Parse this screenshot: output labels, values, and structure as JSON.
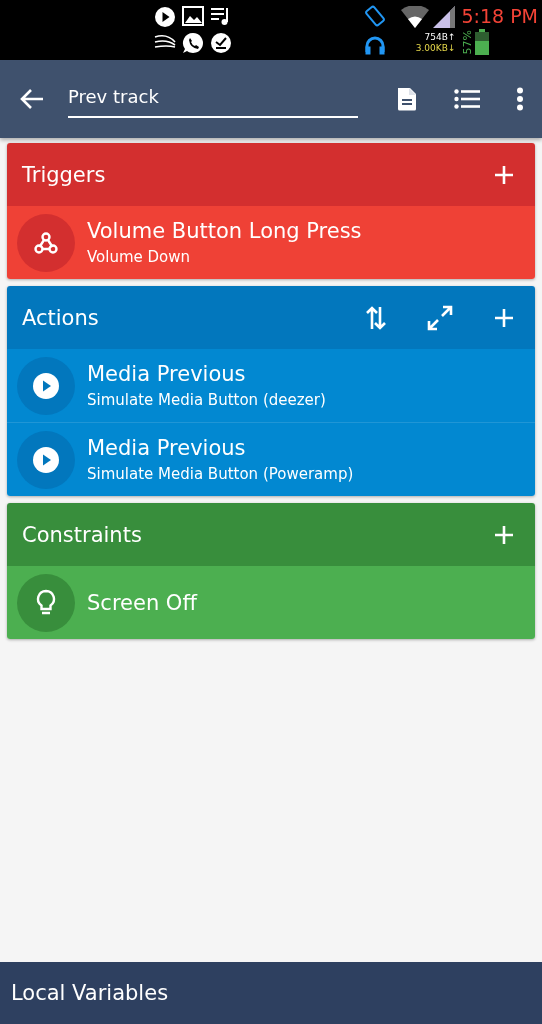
{
  "status_bar": {
    "time": "5:18 PM",
    "upload": "754B↑",
    "download": "3.00KB↓",
    "battery": "57%"
  },
  "app_bar": {
    "title": "Prev track"
  },
  "sections": [
    {
      "kind": "triggers",
      "title": "Triggers",
      "items": [
        {
          "title": "Volume Button Long Press",
          "subtitle": "Volume Down"
        }
      ]
    },
    {
      "kind": "actions",
      "title": "Actions",
      "items": [
        {
          "title": "Media Previous",
          "subtitle": "Simulate Media Button (deezer)"
        },
        {
          "title": "Media Previous",
          "subtitle": "Simulate Media Button (Poweramp)"
        }
      ]
    },
    {
      "kind": "constraints",
      "title": "Constraints",
      "items": [
        {
          "title": "Screen Off"
        }
      ]
    }
  ],
  "bottom_bar": {
    "title": "Local Variables"
  }
}
